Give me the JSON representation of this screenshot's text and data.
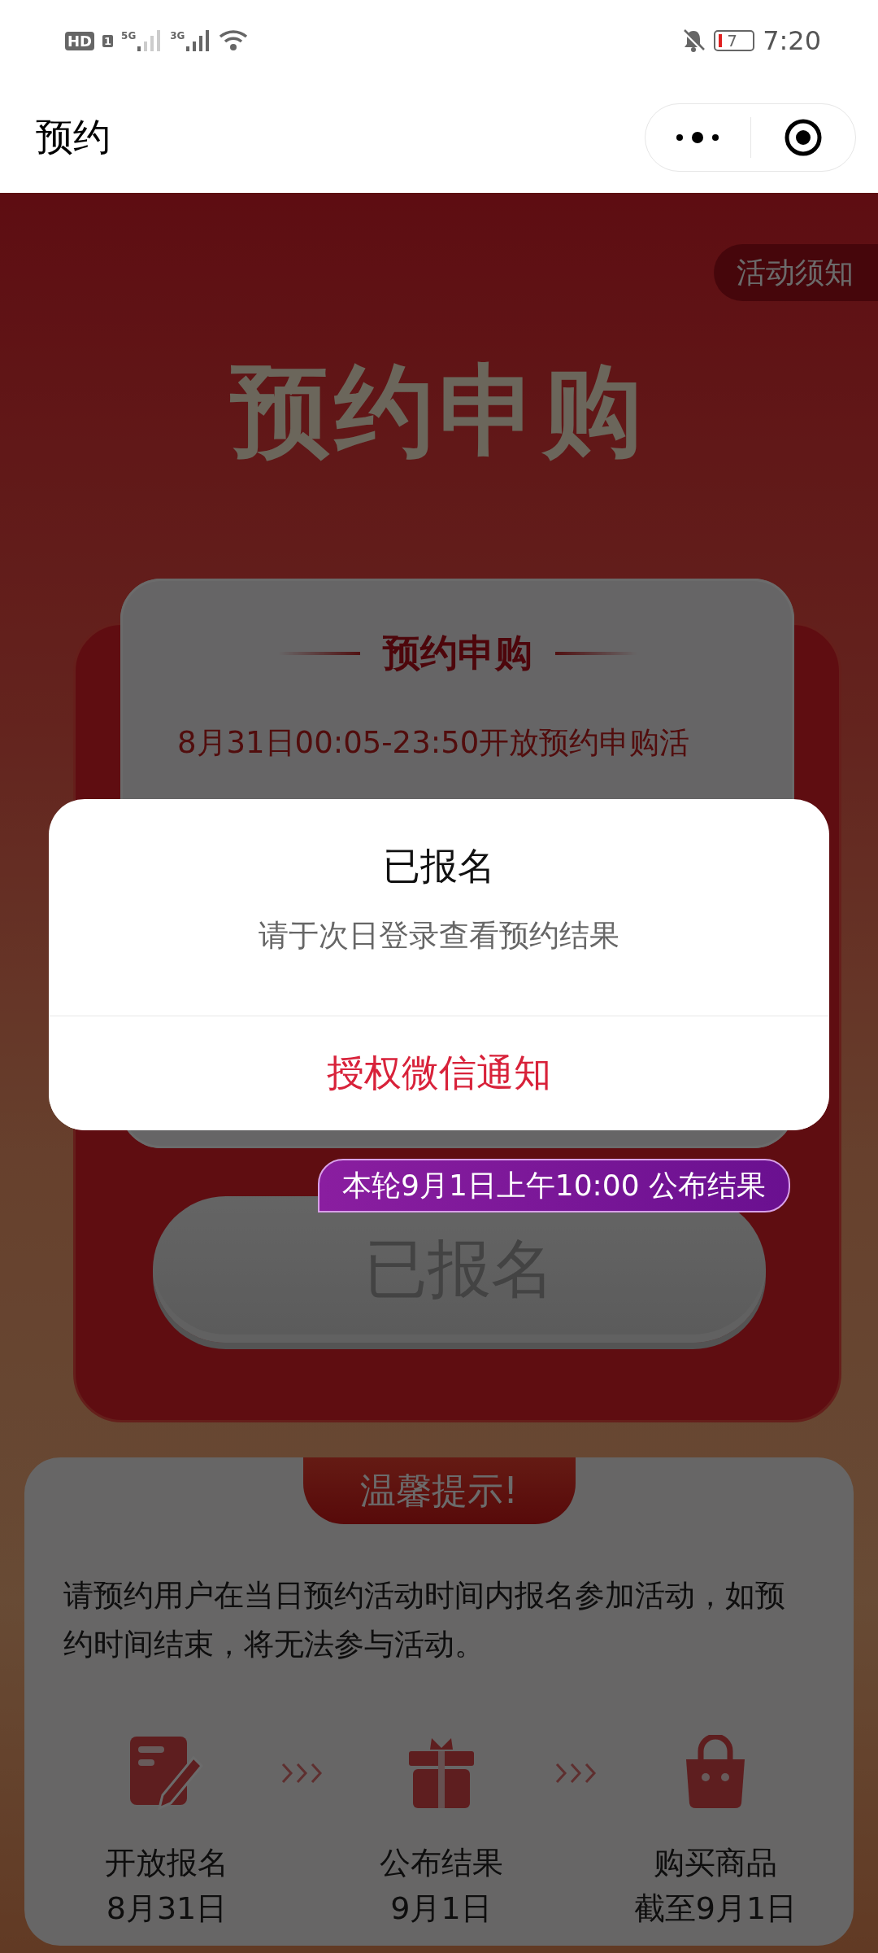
{
  "status_bar": {
    "hd": "HD",
    "sim": "1",
    "net_1": "5G",
    "net_2": "3G",
    "battery": "7",
    "time": "7:20"
  },
  "nav": {
    "title": "预约"
  },
  "notice_tag": "活动须知",
  "hero_title": "预约申购",
  "card": {
    "title": "预约申购",
    "intro": "8月31日00:05-23:50开放预约申购活"
  },
  "result_badge": "本轮9月1日上午10:00 公布结果",
  "signup_button": {
    "label": "已报名",
    "disabled": true
  },
  "tips": {
    "title": "温馨提示!",
    "text": "请预约用户在当日预约活动时间内报名参加活动，如预约时间结束，将无法参与活动。",
    "steps": [
      {
        "kind": "form",
        "label": "开放报名",
        "date": "8月31日"
      },
      {
        "kind": "gift",
        "label": "公布结果",
        "date": "9月1日"
      },
      {
        "kind": "bag",
        "label": "购买商品",
        "date": "截至9月1日"
      }
    ]
  },
  "dialog": {
    "title": "已报名",
    "message": "请于次日登录查看预约结果",
    "action": "授权微信通知"
  }
}
